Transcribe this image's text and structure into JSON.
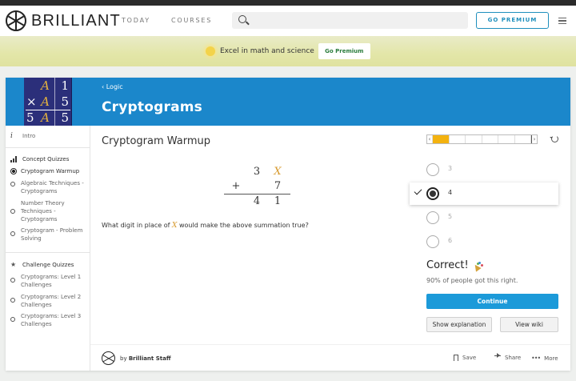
{
  "nav": {
    "brand": "BRILLIANT",
    "links": [
      "TODAY",
      "COURSES"
    ],
    "search_placeholder": "",
    "premium_label": "GO PREMIUM"
  },
  "banner": {
    "text": "Excel in math and science",
    "button": "Go Premium"
  },
  "course": {
    "breadcrumb": "‹ Logic",
    "title": "Cryptograms",
    "thumbnail": {
      "rows": [
        [
          "A",
          "1"
        ],
        [
          "A",
          "5"
        ],
        [
          "A",
          "5"
        ]
      ],
      "left_digits": [
        "",
        "×",
        "5"
      ]
    }
  },
  "sidebar": {
    "intro": "Intro",
    "concept_header": "Concept Quizzes",
    "concept_items": [
      "Cryptogram Warmup",
      "Algebraic Techniques - Cryptograms",
      "Number Theory Techniques - Cryptograms",
      "Cryptogram - Problem Solving"
    ],
    "challenge_header": "Challenge Quizzes",
    "challenge_items": [
      "Cryptograms: Level 1 Challenges",
      "Cryptograms: Level 2 Challenges",
      "Cryptograms: Level 3 Challenges"
    ]
  },
  "problem": {
    "title": "Cryptogram Warmup",
    "sum": {
      "row1": [
        "3",
        "X"
      ],
      "row2_op": "+",
      "row2": [
        "7"
      ],
      "result": [
        "4",
        "1"
      ]
    },
    "question_pre": "What digit in place of ",
    "question_var": "X",
    "question_post": " would make the above summation true?"
  },
  "progress": {
    "segments": 6,
    "active_index": 0,
    "left_arrow": "‹",
    "right_arrow": "›"
  },
  "options": [
    "3",
    "4",
    "5",
    "6"
  ],
  "selected_option": "4",
  "result": {
    "title": "Correct!",
    "stat": "90% of people got this right.",
    "continue": "Continue",
    "explanation": "Show explanation",
    "wiki": "View wiki"
  },
  "footer": {
    "by": "by ",
    "author": "Brilliant Staff",
    "save": "Save",
    "share": "Share",
    "more": "More"
  },
  "colors": {
    "header_blue": "#1b87cb",
    "accent_gold": "#f3b20f",
    "continue_blue": "#1c9ad9",
    "var_orange": "#d79a2e"
  }
}
